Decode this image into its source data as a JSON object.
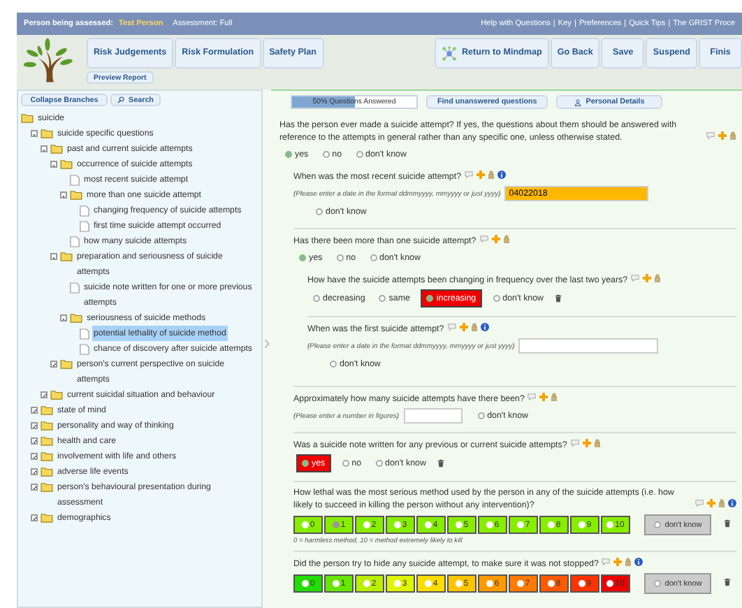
{
  "header": {
    "person_label": "Person being assessed:",
    "person_name": "Test Person",
    "assessment": "Assessment: Full",
    "links": [
      "Help with Questions",
      "Key",
      "Preferences",
      "Quick Tips",
      "The GRIST Proce"
    ],
    "separator": "|"
  },
  "toolbar": {
    "left_buttons": [
      "Risk Judgements",
      "Risk Formulation",
      "Safety Plan"
    ],
    "preview": "Preview Report",
    "right_buttons": [
      {
        "label": "Return to Mindmap",
        "kind": "mindmap"
      },
      {
        "label": "Go Back",
        "kind": "plain"
      },
      {
        "label": "Save",
        "kind": "plain"
      },
      {
        "label": "Suspend",
        "kind": "plain"
      },
      {
        "label": "Finis",
        "kind": "plain"
      }
    ]
  },
  "tree_panel": {
    "buttons": [
      {
        "label": "Collapse Branches",
        "kind": "plain"
      },
      {
        "label": "Search",
        "kind": "search"
      }
    ],
    "items": [
      {
        "label": "suicide",
        "kind": "folder",
        "selected": false,
        "children": [
          {
            "label": "suicide specific questions",
            "kind": "folder",
            "expanded": true,
            "selected": false,
            "children": [
              {
                "label": "past and current suicide attempts",
                "kind": "folder",
                "expanded": true,
                "selected": false,
                "children": [
                  {
                    "label": "occurrence of suicide attempts",
                    "kind": "folder",
                    "expanded": true,
                    "selected": false,
                    "children": [
                      {
                        "label": "most recent suicide attempt",
                        "kind": "page",
                        "selected": false
                      },
                      {
                        "label": "more than one suicide attempt",
                        "kind": "folder",
                        "expanded": true,
                        "selected": false,
                        "children": [
                          {
                            "label": "changing frequency of suicide attempts",
                            "kind": "page",
                            "selected": false
                          },
                          {
                            "label": "first time suicide attempt occurred",
                            "kind": "page",
                            "selected": false
                          }
                        ]
                      },
                      {
                        "label": "how many suicide attempts",
                        "kind": "page",
                        "selected": false
                      }
                    ]
                  },
                  {
                    "label": "preparation and seriousness of suicide attempts",
                    "kind": "folder",
                    "expanded": true,
                    "selected": false,
                    "children": [
                      {
                        "label": "suicide note written for one or more previous attempts",
                        "kind": "page",
                        "selected": false
                      },
                      {
                        "label": "seriousness of suicide methods",
                        "kind": "folder",
                        "expanded": true,
                        "selected": false,
                        "children": [
                          {
                            "label": "potential lethality of suicide method",
                            "kind": "page",
                            "selected": true
                          },
                          {
                            "label": "chance of discovery after suicide attempts",
                            "kind": "page",
                            "selected": false
                          }
                        ]
                      }
                    ]
                  },
                  {
                    "label": "person's current perspective on suicide attempts",
                    "kind": "folder",
                    "expanded": false,
                    "selected": false
                  }
                ]
              },
              {
                "label": "current suicidal situation and behaviour",
                "kind": "folder",
                "expanded": false,
                "selected": false
              }
            ]
          },
          {
            "label": "state of mind",
            "kind": "folder",
            "expanded": false,
            "selected": false
          },
          {
            "label": "personality and way of thinking",
            "kind": "folder",
            "expanded": false,
            "selected": false
          },
          {
            "label": "health and care",
            "kind": "folder",
            "expanded": false,
            "selected": false
          },
          {
            "label": "involvement with life and others",
            "kind": "folder",
            "expanded": false,
            "selected": false
          },
          {
            "label": "adverse life events",
            "kind": "folder",
            "expanded": false,
            "selected": false
          },
          {
            "label": "person's behavioural presentation during assessment",
            "kind": "folder",
            "expanded": false,
            "selected": false
          },
          {
            "label": "demographics",
            "kind": "folder",
            "expanded": false,
            "selected": false
          }
        ]
      }
    ]
  },
  "progress": {
    "label": "50% Questions Answered",
    "level": 0.5
  },
  "actions": [
    {
      "label": "Find unanswered questions",
      "kind": "plain"
    },
    {
      "label": "Personal Details",
      "kind": "person"
    }
  ],
  "questions": [
    {
      "kind": "radio",
      "text": "Has the person ever made a suicide attempt? If yes, the questions about them should be answered with reference to the attempts in general rather than any specific one, unless otherwise stated.",
      "options": [
        {
          "label": "yes",
          "selected": true
        },
        {
          "label": "no",
          "selected": false
        },
        {
          "label": "don't know",
          "selected": false
        }
      ],
      "children": [
        {
          "kind": "date",
          "text": "When was the most recent suicide attempt?",
          "info": true,
          "hint": "(Please enter a date in the format ddmmyyyy, mmyyyy or just yyyy)",
          "value": "04022018",
          "dont_know": {
            "label": "don't know",
            "selected": false
          }
        },
        {
          "kind": "radio",
          "text": "Has there been more than one suicide attempt?",
          "options": [
            {
              "label": "yes",
              "selected": true
            },
            {
              "label": "no",
              "selected": false
            },
            {
              "label": "don't know",
              "selected": false
            }
          ],
          "children": [
            {
              "kind": "radio",
              "text": "How have the suicide attempts been changing in frequency over the last two years?",
              "trash": true,
              "options": [
                {
                  "label": "decreasing",
                  "selected": false
                },
                {
                  "label": "same",
                  "selected": false
                },
                {
                  "label": "increasing",
                  "selected": true,
                  "color": "#ee0000"
                },
                {
                  "label": "don't know",
                  "selected": false
                }
              ]
            },
            {
              "kind": "date",
              "text": "When was the first suicide attempt?",
              "info": true,
              "hint": "(Please enter a date in the format ddmmyyyy, mmyyyy or just yyyy)",
              "dont_know": {
                "label": "don't know",
                "selected": false
              }
            }
          ]
        },
        {
          "kind": "number",
          "text": "Approximately how many suicide attempts have there been?",
          "hint": "(Please enter a number in figures)",
          "dont_know": {
            "label": "don't know",
            "selected": false
          }
        },
        {
          "kind": "radio",
          "text": "Was a suicide note written for any previous or current suicide attempts?",
          "trash": true,
          "options": [
            {
              "label": "yes",
              "selected": true,
              "color": "#ee0000"
            },
            {
              "label": "no",
              "selected": false
            },
            {
              "label": "don't know",
              "selected": false
            }
          ]
        },
        {
          "kind": "scale",
          "text": "How lethal was the most serious method used by the person in any of the suicide attempts (i.e. how likely to succeed in killing the person without any intervention)?",
          "info": true,
          "trash": true,
          "legend": "0 = harmless method, 10 = method extremely likely to kill",
          "dont_know": {
            "label": "don't know",
            "selected": false
          },
          "options": [
            {
              "label": "0",
              "selected": false,
              "color": "#88ee00"
            },
            {
              "label": "1",
              "selected": true,
              "color": "#88ee00"
            },
            {
              "label": "2",
              "selected": false,
              "color": "#88ee00"
            },
            {
              "label": "3",
              "selected": false,
              "color": "#88ee00"
            },
            {
              "label": "4",
              "selected": false,
              "color": "#88ee00"
            },
            {
              "label": "5",
              "selected": false,
              "color": "#88ee00"
            },
            {
              "label": "6",
              "selected": false,
              "color": "#88ee00"
            },
            {
              "label": "7",
              "selected": false,
              "color": "#88ee00"
            },
            {
              "label": "8",
              "selected": false,
              "color": "#88ee00"
            },
            {
              "label": "9",
              "selected": false,
              "color": "#88ee00"
            },
            {
              "label": "10",
              "selected": false,
              "color": "#88ee00"
            }
          ]
        },
        {
          "kind": "scale",
          "text": "Did the person try to hide any suicide attempt, to make sure it was not stopped?",
          "info": true,
          "trash": true,
          "dont_know": {
            "label": "don't know",
            "selected": false
          },
          "options": [
            {
              "label": "0",
              "selected": false,
              "color": "#22dd00"
            },
            {
              "label": "1",
              "selected": false,
              "color": "#66e600"
            },
            {
              "label": "2",
              "selected": false,
              "color": "#bbee00"
            },
            {
              "label": "3",
              "selected": false,
              "color": "#ddf500"
            },
            {
              "label": "4",
              "selected": false,
              "color": "#ffdd00"
            },
            {
              "label": "5",
              "selected": false,
              "color": "#ffc400"
            },
            {
              "label": "6",
              "selected": false,
              "color": "#ff9900"
            },
            {
              "label": "7",
              "selected": false,
              "color": "#ff7a00"
            },
            {
              "label": "8",
              "selected": false,
              "color": "#ff5a00"
            },
            {
              "label": "9",
              "selected": false,
              "color": "#ff3300"
            },
            {
              "label": "10",
              "selected": false,
              "color": "#ee0000"
            }
          ]
        }
      ]
    }
  ]
}
